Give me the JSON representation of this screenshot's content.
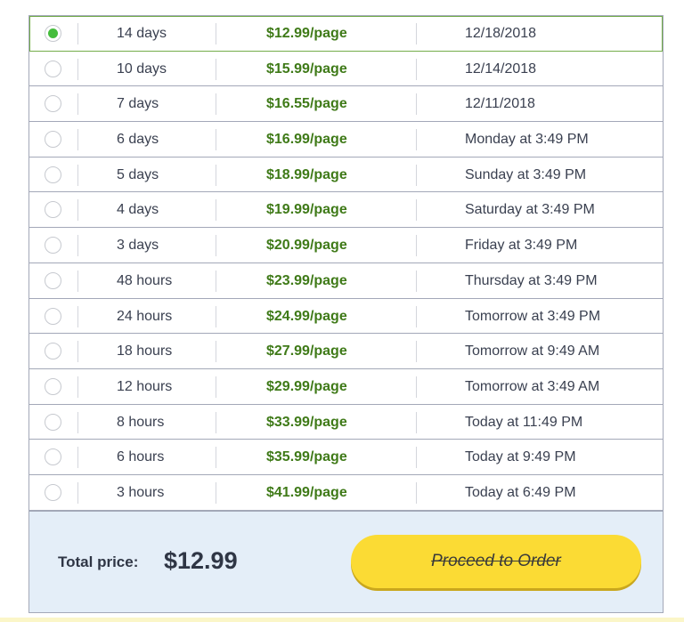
{
  "options": [
    {
      "duration": "14 days",
      "price": "$12.99/page",
      "deadline": "12/18/2018",
      "selected": true
    },
    {
      "duration": "10 days",
      "price": "$15.99/page",
      "deadline": "12/14/2018",
      "selected": false
    },
    {
      "duration": "7 days",
      "price": "$16.55/page",
      "deadline": "12/11/2018",
      "selected": false
    },
    {
      "duration": "6 days",
      "price": "$16.99/page",
      "deadline": "Monday at 3:49 PM",
      "selected": false
    },
    {
      "duration": "5 days",
      "price": "$18.99/page",
      "deadline": "Sunday at 3:49 PM",
      "selected": false
    },
    {
      "duration": "4 days",
      "price": "$19.99/page",
      "deadline": "Saturday at 3:49 PM",
      "selected": false
    },
    {
      "duration": "3 days",
      "price": "$20.99/page",
      "deadline": "Friday at 3:49 PM",
      "selected": false
    },
    {
      "duration": "48 hours",
      "price": "$23.99/page",
      "deadline": "Thursday at 3:49 PM",
      "selected": false
    },
    {
      "duration": "24 hours",
      "price": "$24.99/page",
      "deadline": "Tomorrow at 3:49 PM",
      "selected": false
    },
    {
      "duration": "18 hours",
      "price": "$27.99/page",
      "deadline": "Tomorrow at 9:49 AM",
      "selected": false
    },
    {
      "duration": "12 hours",
      "price": "$29.99/page",
      "deadline": "Tomorrow at 3:49 AM",
      "selected": false
    },
    {
      "duration": "8 hours",
      "price": "$33.99/page",
      "deadline": "Today at 11:49 PM",
      "selected": false
    },
    {
      "duration": "6 hours",
      "price": "$35.99/page",
      "deadline": "Today at 9:49 PM",
      "selected": false
    },
    {
      "duration": "3 hours",
      "price": "$41.99/page",
      "deadline": "Today at 6:49 PM",
      "selected": false
    }
  ],
  "footer": {
    "total_label": "Total price:",
    "total_value": "$12.99",
    "proceed_label": "Proceed to Order"
  },
  "colors": {
    "accent_green": "#45bd3c",
    "price_green": "#3f7a18",
    "button_yellow": "#fbdb34",
    "footer_bg": "#e4eef8"
  }
}
